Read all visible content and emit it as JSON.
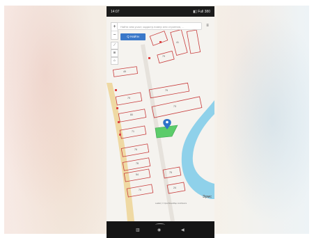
{
  "status_bar": {
    "time": "14:07",
    "indicators": "▮▯ Full 380"
  },
  "search": {
    "placeholder": "Найти зем.участ, кадастр.номер или строения, ...",
    "button_label": "Q Найти"
  },
  "map": {
    "zoom_in": "+",
    "zoom_out": "−",
    "menu_icon": "≡",
    "tool_icons": [
      "ruler-icon",
      "layers-icon",
      "home-icon"
    ],
    "logo": "Эрмс",
    "attribution": "Leaflet | © OpenStreetMap contributors",
    "colors": {
      "parcel_border": "#c83c3c",
      "selected_parcel": "#5ccc6a",
      "marker": "#2e72c9",
      "river": "#8fd1ea",
      "road": "#efd9a3"
    },
    "parcel_labels": [
      "49",
      "79",
      "80",
      "71",
      "76",
      "78",
      "54",
      "70",
      "79",
      "73",
      "79",
      "41",
      "75",
      "24"
    ]
  },
  "nav_bar": {
    "recent_icon": "▥",
    "home_icon": "◉",
    "back_icon": "◀"
  }
}
